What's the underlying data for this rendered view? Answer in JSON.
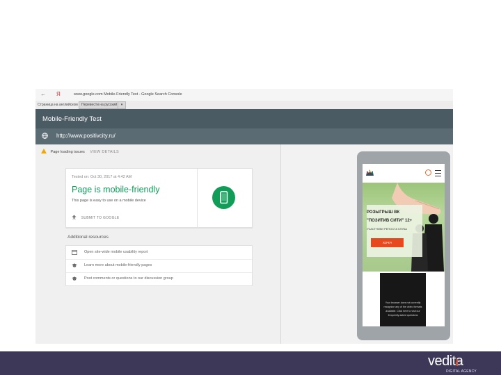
{
  "browser": {
    "back": "←",
    "yandex": "Я",
    "address": "www.google.com  Mobile-Friendly Test - Google Search Console"
  },
  "translate_bar": {
    "text": "Страница на английском",
    "translate_button": "Перевести на русский",
    "options": "▾"
  },
  "app": {
    "title": "Mobile-Friendly Test",
    "url": "http://www.positivcity.ru/"
  },
  "issues": {
    "label": "Page loading issues",
    "view_details": "VIEW DETAILS"
  },
  "result": {
    "tested_on": "Tested on: Oct 30, 2017 at 4:42 AM",
    "title": "Page is mobile-friendly",
    "subtitle": "This page is easy to use on a mobile device",
    "submit": "SUBMIT TO GOOGLE"
  },
  "additional": {
    "label": "Additional resources",
    "items": [
      {
        "label": "Open site-wide mobile usability report",
        "icon": "report-icon"
      },
      {
        "label": "Learn more about mobile-friendly pages",
        "icon": "school-icon"
      },
      {
        "label": "Post comments or questions to our discussion group",
        "icon": "school-icon"
      }
    ]
  },
  "preview": {
    "promo_line1": "РОЗЫГРЫШ ВК",
    "promo_line2": "\"ПОЗИТИВ СИТИ\" 12+",
    "promo_line3": "УЧАСТНИКИ РЕПОСТА КЛУБА",
    "promo_button": "ХОЧУ!",
    "video_text": "Your browser does not currently recognize any of the video formats available. Click here to visit our frequently asked questions"
  },
  "footer": {
    "brand": "vedita",
    "brand_sub": "DIGITAL AGENCY"
  },
  "colors": {
    "header": "#4b5b63",
    "url_bar": "#5a6b73",
    "success": "#0f9d58",
    "warning": "#f2a600",
    "promo_button": "#e8481e",
    "footer": "#3d3758"
  }
}
